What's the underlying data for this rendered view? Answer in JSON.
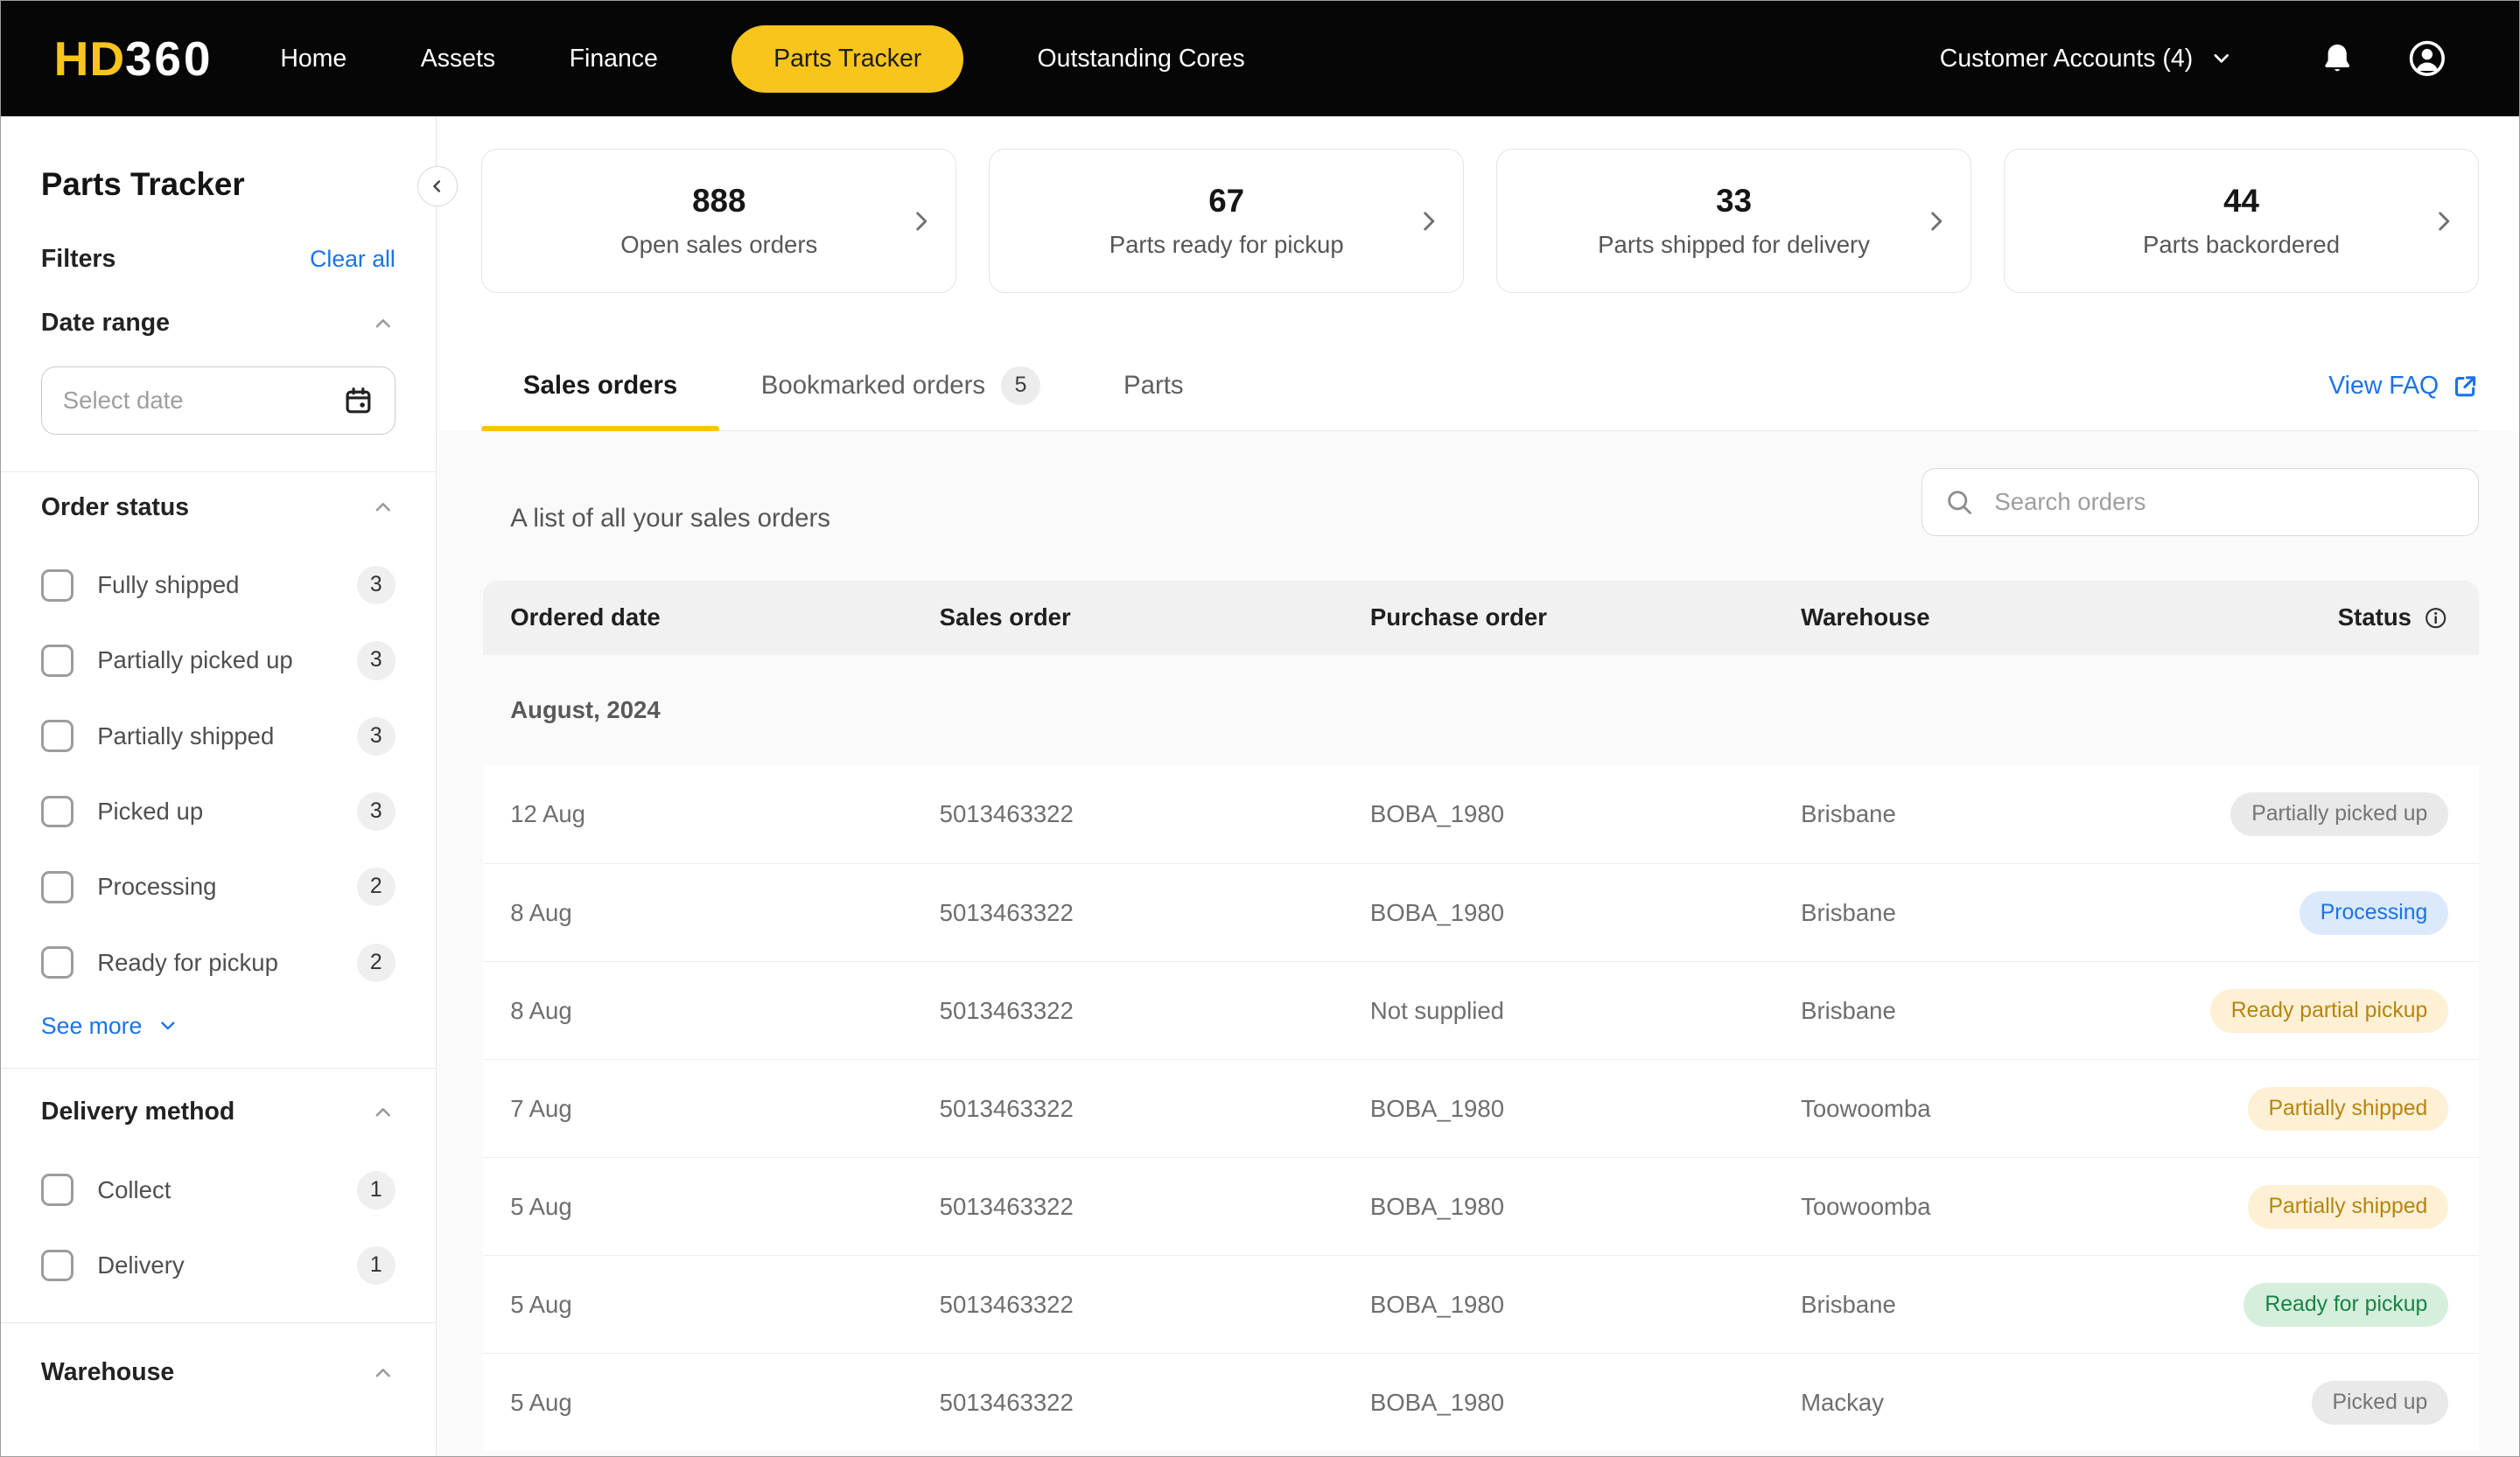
{
  "nav": {
    "logo_primary": "HD",
    "logo_secondary": "360",
    "items": {
      "home": "Home",
      "assets": "Assets",
      "finance": "Finance",
      "parts_tracker": "Parts Tracker",
      "outstanding_cores": "Outstanding Cores"
    },
    "account_label": "Customer Accounts (4)"
  },
  "cards": [
    {
      "value": "888",
      "label": "Open sales orders"
    },
    {
      "value": "67",
      "label": "Parts ready for pickup"
    },
    {
      "value": "33",
      "label": "Parts shipped for delivery"
    },
    {
      "value": "44",
      "label": "Parts backordered"
    }
  ],
  "tabs": {
    "sales_orders": "Sales orders",
    "bookmarked_orders": "Bookmarked orders",
    "bookmarked_badge": "5",
    "parts": "Parts",
    "faq_link": "View FAQ"
  },
  "sidebar": {
    "title": "Parts Tracker",
    "filters_label": "Filters",
    "clear_all": "Clear all",
    "date_range": {
      "title": "Date range",
      "placeholder": "Select date"
    },
    "order_status": {
      "title": "Order status",
      "options": [
        {
          "label": "Fully shipped",
          "count": "3"
        },
        {
          "label": "Partially picked up",
          "count": "3"
        },
        {
          "label": "Partially shipped",
          "count": "3"
        },
        {
          "label": "Picked up",
          "count": "3"
        },
        {
          "label": "Processing",
          "count": "2"
        },
        {
          "label": "Ready for pickup",
          "count": "2"
        }
      ],
      "see_more": "See more"
    },
    "delivery_method": {
      "title": "Delivery method",
      "options": [
        {
          "label": "Collect",
          "count": "1"
        },
        {
          "label": "Delivery",
          "count": "1"
        }
      ]
    },
    "warehouse": {
      "title": "Warehouse"
    }
  },
  "orders": {
    "caption": "A list of all your sales orders",
    "search_placeholder": "Search orders",
    "columns": [
      "Ordered date",
      "Sales order",
      "Purchase order",
      "Warehouse",
      "Status"
    ],
    "group_label": "August, 2024",
    "rows": [
      {
        "date": "12 Aug",
        "sales_order": "5013463322",
        "purchase_order": "BOBA_1980",
        "warehouse": "Brisbane",
        "status": "Partially picked up",
        "status_type": "gray"
      },
      {
        "date": "8 Aug",
        "sales_order": "5013463322",
        "purchase_order": "BOBA_1980",
        "warehouse": "Brisbane",
        "status": "Processing",
        "status_type": "blue"
      },
      {
        "date": "8 Aug",
        "sales_order": "5013463322",
        "purchase_order": "Not supplied",
        "warehouse": "Brisbane",
        "status": "Ready partial pickup",
        "status_type": "amber"
      },
      {
        "date": "7 Aug",
        "sales_order": "5013463322",
        "purchase_order": "BOBA_1980",
        "warehouse": "Toowoomba",
        "status": "Partially shipped",
        "status_type": "amber"
      },
      {
        "date": "5 Aug",
        "sales_order": "5013463322",
        "purchase_order": "BOBA_1980",
        "warehouse": "Toowoomba",
        "status": "Partially shipped",
        "status_type": "amber"
      },
      {
        "date": "5 Aug",
        "sales_order": "5013463322",
        "purchase_order": "BOBA_1980",
        "warehouse": "Brisbane",
        "status": "Ready for pickup",
        "status_type": "green"
      },
      {
        "date": "5 Aug",
        "sales_order": "5013463322",
        "purchase_order": "BOBA_1980",
        "warehouse": "Mackay",
        "status": "Picked up",
        "status_type": "gray"
      }
    ]
  },
  "colors": {
    "brand_yellow": "#F8C51C",
    "tab_underline": "#FDC500",
    "link_blue": "#1A73E8",
    "chip_gray_bg": "#E9E9E9",
    "chip_gray_text": "#757575",
    "chip_blue_bg": "#DCE9FB",
    "chip_blue_text": "#1A73E8",
    "chip_amber_bg": "#FDF0D5",
    "chip_amber_text": "#B5850E",
    "chip_green_bg": "#D5EFDC",
    "chip_green_text": "#1A8245"
  }
}
